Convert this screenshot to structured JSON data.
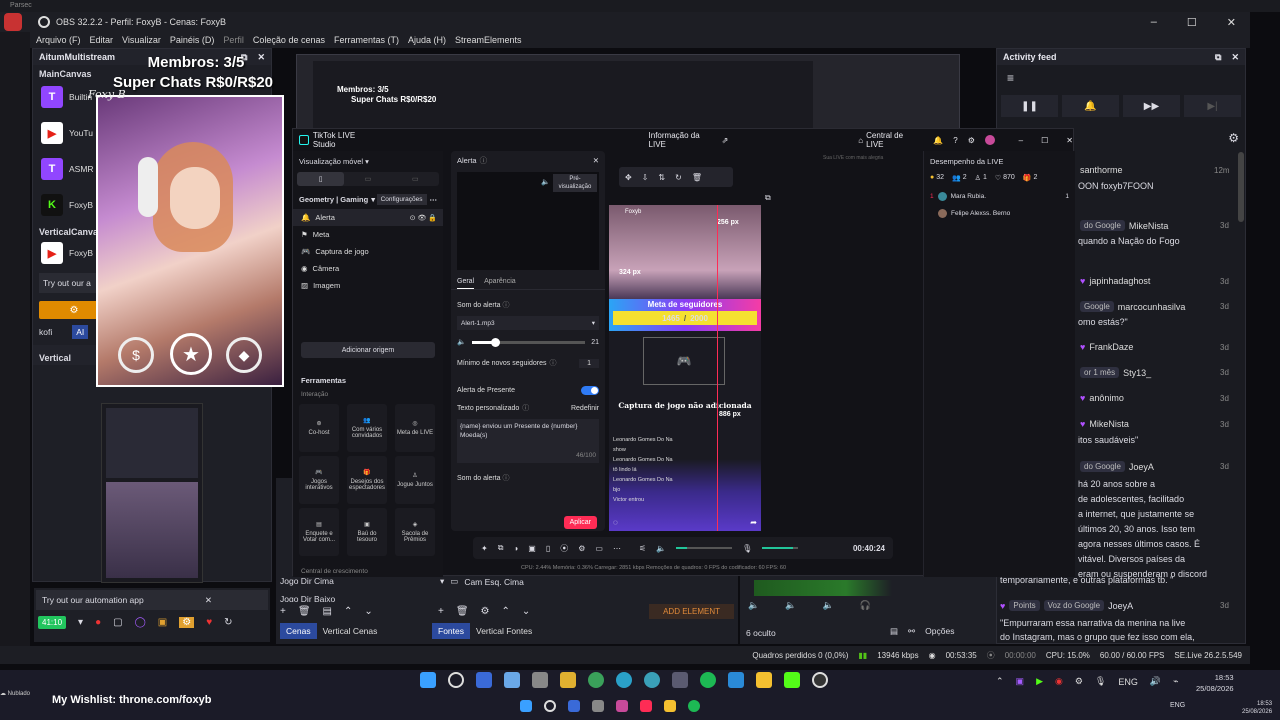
{
  "system": {
    "app_hint": "Parsec"
  },
  "obs": {
    "title": "OBS 32.2.2 - Perfil: FoxyB - Cenas: FoxyB",
    "menu": [
      "Arquivo (F)",
      "Editar",
      "Visualizar",
      "Painéis (D)",
      "Perfil",
      "Coleção de cenas",
      "Ferramentas (T)",
      "Ajuda (H)",
      "StreamElements"
    ],
    "multistream": {
      "title": "AitumMultistream",
      "main_label": "MainCanvas",
      "vertical_label": "VerticalCanva",
      "vertical_section": "Vertical",
      "items": [
        {
          "name": "Builtin",
          "color": "#9146ff",
          "glyph": "T"
        },
        {
          "name": "YouTu",
          "color": "#e62117",
          "glyph": "▶"
        },
        {
          "name": "ASMR",
          "color": "#9146ff",
          "glyph": "T"
        },
        {
          "name": "FoxyB",
          "color": "#53fc18",
          "glyph": "K"
        }
      ],
      "vertical_items": [
        {
          "name": "FoxyB",
          "color": "#e62117",
          "glyph": "▶"
        }
      ],
      "try_text": "Try out our a",
      "kofi": "kofi",
      "ai": "AI"
    },
    "automation": {
      "text": "Try out our automation app",
      "time": "41:10"
    },
    "scenes": {
      "items": [
        "Jogo Dir Cima",
        "Jogo Dir Baixo"
      ],
      "tab_scenes": "Cenas",
      "tab_vertical": "Vertical Cenas"
    },
    "sources": {
      "items": [
        "Cam Esq. Cima"
      ],
      "tab_sources": "Fontes",
      "tab_vertical": "Vertical Fontes",
      "add_element": "ADD ELEMENT"
    },
    "mixer": {
      "hidden": "6 oculto",
      "options": "Opções"
    },
    "status": {
      "dropped": "Quadros perdidos 0 (0,0%)",
      "kbps": "13946 kbps",
      "stream_time": "00:53:35",
      "rec_time": "00:00:00",
      "cpu": "CPU: 15.0%",
      "fps": "60.00 / 60.00 FPS",
      "version": "SE.Live 26.2.5.549"
    }
  },
  "overlay": {
    "members": "Membros: 3/5",
    "superchats": "Super Chats R$0/R$20",
    "watermark": "Foxy B"
  },
  "preview_mini": {
    "members": "Membros: 3/5",
    "superchats": "Super Chats R$0/R$20"
  },
  "activity": {
    "title": "Activity feed",
    "items": [
      {
        "label": "santhorme",
        "time": "12m",
        "detail": "OON foxyb7FOON",
        "badge": ""
      },
      {
        "label": "MikeNista",
        "time": "3d",
        "detail": "quando a Nação do Fogo",
        "badge": "do Google"
      },
      {
        "label": "japinhadaghost",
        "time": "3d",
        "detail": "",
        "badge": ""
      },
      {
        "label": "marcocunhasilva",
        "time": "3d",
        "detail": "omo estás?\"",
        "badge": "Google"
      },
      {
        "label": "FrankDaze",
        "time": "3d",
        "detail": "",
        "badge": ""
      },
      {
        "label": "Sty13_",
        "time": "3d",
        "detail": "",
        "badge": "or 1 mês"
      },
      {
        "label": "anônimo",
        "time": "3d",
        "detail": "",
        "badge": ""
      },
      {
        "label": "MikeNista",
        "time": "3d",
        "detail": "itos saudáveis\"",
        "badge": "do Google"
      },
      {
        "label": "JoeyA",
        "time": "3d",
        "detail": "",
        "badge": "do Google"
      }
    ],
    "long_text": [
      "há 20 anos sobre a",
      "de adolescentes, facilitado",
      "a internet, que justamente se",
      "últimos 20, 30 anos. Isso tem",
      "agora nesses últimos casos. É",
      "vitável. Diversos países da",
      "eram ou suspenderam o discord",
      "temporariamente, e outras plataformas tb. \""
    ],
    "last": {
      "points": "Points",
      "badge": "Voz do Google",
      "user": "JoeyA",
      "time": "3d",
      "text": [
        "\"Empurraram essa narrativa da menina na live",
        "do Instagram, mas o grupo que fez isso com ela,"
      ]
    }
  },
  "tiktok": {
    "title": "TikTok LIVE Studio",
    "live_info": "Informação da LIVE",
    "center": "Central de LIVE",
    "mode": "Visualização móvel",
    "scene": "Geometry | Gaming",
    "settings": "Configurações",
    "sources": [
      "Alerta",
      "Meta",
      "Captura de jogo",
      "Câmera",
      "Imagem"
    ],
    "add_source": "Adicionar origem",
    "tools_title": "Ferramentas",
    "interaction": "Interação",
    "tools": [
      "Co-host",
      "Com vários convidados",
      "Meta de LIVE",
      "Jogos interativos",
      "Desejos dos espectadores",
      "Jogue Juntos",
      "Enquete e Votar com...",
      "Baú do tesouro",
      "Sacola de Prêmios"
    ],
    "growth": "Central de crescimento",
    "alert_panel": {
      "title": "Alerta",
      "preview": "Pré-visualização",
      "tab_general": "Geral",
      "tab_appearance": "Aparência",
      "sound_label": "Som do alerta",
      "sound_value": "Alert-1.mp3",
      "volume": "21",
      "min_followers_label": "Mínimo de novos seguidores",
      "min_followers": "1",
      "gift_alert": "Alerta de Presente",
      "custom_text_label": "Texto personalizado",
      "reset": "Redefinir",
      "custom_text": "{name} enviou um Presente de {number} Moeda(s)",
      "counter": "46/100",
      "sound_label2": "Som do alerta",
      "apply": "Aplicar"
    },
    "phone": {
      "name": "Foxyb",
      "measure_top": "256 px",
      "measure_left": "324 px",
      "measure_right": "886 px",
      "goal_title": "Meta de seguidores",
      "goal_value": "1465",
      "goal_total": "2000",
      "capture_text": "Captura de jogo não adicionada",
      "chat": [
        {
          "name": "Leonardo Gomes Do Na",
          "text": "show"
        },
        {
          "name": "Leonardo Gomes Do Na",
          "text": "tô lindo lá"
        },
        {
          "name": "Leonardo Gomes Do Na",
          "text": "bjo"
        },
        {
          "name": "Victor",
          "text": "entrou"
        }
      ]
    },
    "perf": {
      "title": "Desempenho da LIVE",
      "stats": [
        "32",
        "2",
        "1",
        "870",
        "2"
      ],
      "ranks": [
        {
          "pos": "1",
          "name": "Mara Rubia.",
          "val": "1"
        },
        {
          "pos": "",
          "name": "Felipe Alexss. Berno",
          "val": ""
        }
      ]
    },
    "timer": "00:40:24",
    "footer": "CPU: 2.44%   Memória: 0.36%   Carregar: 2851 kbps   Remoções de quadros: 0   FPS do codificador: 60   FPS: 60",
    "chat_hint": "Sua LIVE com mais alegria"
  },
  "taskbar": {
    "wishlist": "My Wishlist: throne.com/foxyb",
    "weather": "Nublado",
    "time": "18:53",
    "date": "25/08/2026",
    "lang": "ENG",
    "time2": "18:53",
    "date2": "25/08/2026",
    "lang2": "ENG"
  }
}
